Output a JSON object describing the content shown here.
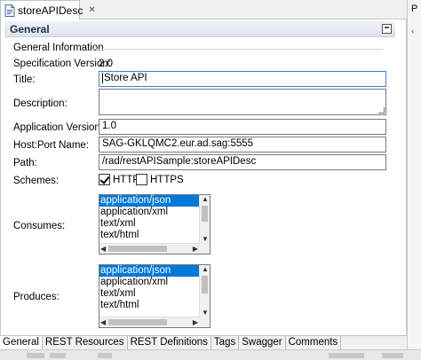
{
  "editor_tab": {
    "title": "storeAPIDesc",
    "close_glyph": "✕",
    "icon": "file-icon"
  },
  "right_strip": {
    "label": "P",
    "chevron": "‹"
  },
  "section": {
    "title": "General",
    "icon": "collapse-icon"
  },
  "group": {
    "title": "General Information"
  },
  "spec_version": {
    "label": "Specification Version:",
    "value": "2.0"
  },
  "form": {
    "title": {
      "label": "Title:",
      "value": "Store API"
    },
    "description": {
      "label": "Description:",
      "value": ""
    },
    "app_version": {
      "label": "Application Version:",
      "value": "1.0"
    },
    "host_port": {
      "label": "Host:Port Name:",
      "value": "SAG-GKLQMC2.eur.ad.sag:5555"
    },
    "path": {
      "label": "Path:",
      "value": "/rad/restAPISample:storeAPIDesc"
    }
  },
  "schemes": {
    "label": "Schemes:",
    "options": [
      {
        "label": "HTTP",
        "checked": true
      },
      {
        "label": "HTTPS",
        "checked": false
      }
    ]
  },
  "consumes": {
    "label": "Consumes:",
    "items": [
      "application/json",
      "application/xml",
      "text/xml",
      "text/html"
    ],
    "selected_index": 0
  },
  "produces": {
    "label": "Produces:",
    "items": [
      "application/json",
      "application/xml",
      "text/xml",
      "text/html"
    ],
    "selected_index": 0
  },
  "scroll_glyphs": {
    "up": "▲",
    "down": "▼",
    "left": "◀",
    "right": "▶"
  },
  "bottom_tabs": [
    {
      "label": "General",
      "active": true
    },
    {
      "label": "REST Resources",
      "active": false
    },
    {
      "label": "REST Definitions",
      "active": false
    },
    {
      "label": "Tags",
      "active": false
    },
    {
      "label": "Swagger",
      "active": false
    },
    {
      "label": "Comments",
      "active": false
    }
  ]
}
